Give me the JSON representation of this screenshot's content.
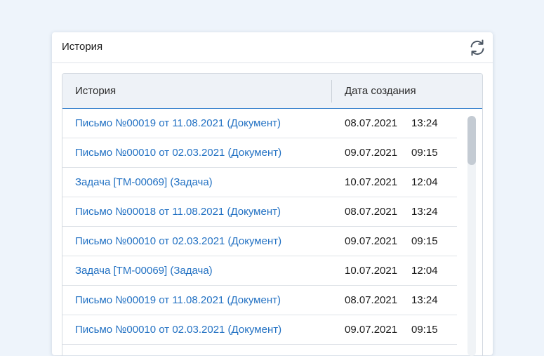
{
  "panel": {
    "title": "История",
    "refresh_icon": "refresh-icon"
  },
  "table": {
    "columns": {
      "history": "История",
      "date": "Дата создания"
    },
    "rows": [
      {
        "title": "Письмо №00019 от 11.08.2021 (Документ)",
        "date": "08.07.2021",
        "time": "13:24"
      },
      {
        "title": "Письмо №00010 от 02.03.2021 (Документ)",
        "date": "09.07.2021",
        "time": "09:15"
      },
      {
        "title": "Задача [ТМ-00069] (Задача)",
        "date": "10.07.2021",
        "time": "12:04"
      },
      {
        "title": "Письмо №00018 от 11.08.2021 (Документ)",
        "date": "08.07.2021",
        "time": "13:24"
      },
      {
        "title": "Письмо №00010 от 02.03.2021 (Документ)",
        "date": "09.07.2021",
        "time": "09:15"
      },
      {
        "title": "Задача [ТМ-00069] (Задача)",
        "date": "10.07.2021",
        "time": "12:04"
      },
      {
        "title": "Письмо №00019 от 11.08.2021 (Документ)",
        "date": "08.07.2021",
        "time": "13:24"
      },
      {
        "title": "Письмо №00010 от 02.03.2021 (Документ)",
        "date": "09.07.2021",
        "time": "09:15"
      }
    ]
  },
  "colors": {
    "link": "#2271c3",
    "header_bg": "#eef2f7",
    "accent_border": "#3f86cf",
    "page_bg": "#eef4fb"
  }
}
